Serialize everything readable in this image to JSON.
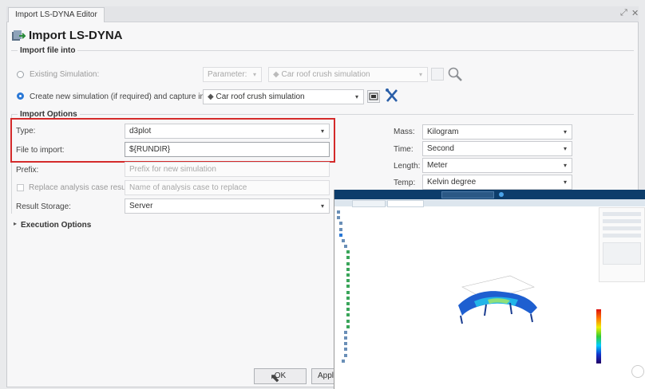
{
  "window": {
    "tab_title": "Import LS-DYNA Editor",
    "dialog_title": "Import LS-DYNA",
    "controls": {
      "restore": "⤢",
      "close": "✕"
    }
  },
  "import_file_into": {
    "legend": "Import file into",
    "existing_label": "Existing Simulation:",
    "existing_param_value": "Parameter:",
    "existing_sim_value": "Car roof crush simulation",
    "create_label": "Create new simulation (if required) and capture in:",
    "create_sim_value": "Car roof crush simulation"
  },
  "import_options": {
    "legend": "Import Options",
    "type_label": "Type:",
    "type_value": "d3plot",
    "file_label": "File to import:",
    "file_value": "${RUNDIR}",
    "prefix_label": "Prefix:",
    "prefix_placeholder": "Prefix for new simulation",
    "replace_label": "Replace analysis case result:",
    "replace_placeholder": "Name of analysis case to replace",
    "storage_label": "Result Storage:",
    "storage_value": "Server",
    "mass_label": "Mass:",
    "mass_value": "Kilogram",
    "time_label": "Time:",
    "time_value": "Second",
    "length_label": "Length:",
    "length_value": "Meter",
    "temp_label": "Temp:",
    "temp_value": "Kelvin degree"
  },
  "execution_options": {
    "label": "Execution Options"
  },
  "footer": {
    "ok_label": "OK",
    "apply_label": "Apply"
  },
  "icons": {
    "dropdown": "▾",
    "expand": "▸",
    "cursor": "⬉"
  },
  "colors": {
    "highlight": "#d42a2a",
    "accent": "#2a78d6",
    "overlay_header": "#0d3d6b"
  }
}
